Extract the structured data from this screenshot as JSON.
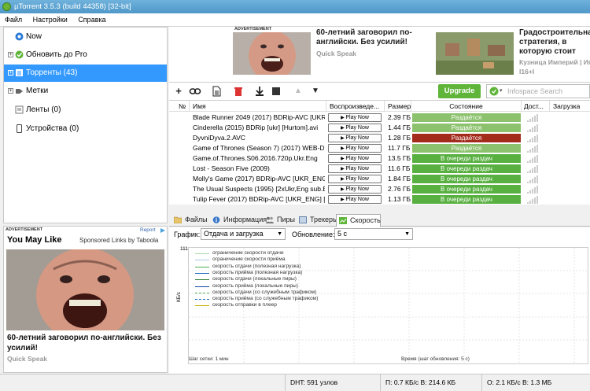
{
  "window": {
    "title": "µTorrent 3.5.3  (build 44358) [32-bit]"
  },
  "menu": [
    "Файл",
    "Настройки",
    "Справка"
  ],
  "sidebar": {
    "items": [
      {
        "label": "Now",
        "icon": "now-icon"
      },
      {
        "label": "Обновить до Pro",
        "icon": "pro-icon"
      },
      {
        "label": "Торренты (43)",
        "icon": "torrents-icon"
      },
      {
        "label": "Метки",
        "icon": "labels-icon"
      },
      {
        "label": "Ленты (0)",
        "icon": "feeds-icon"
      },
      {
        "label": "Устройства (0)",
        "icon": "devices-icon"
      }
    ]
  },
  "top_ads": {
    "label": "ADVERTISEMENT",
    "ad1": {
      "title": "60-летний заговорил по-английски. Без усилий!",
      "source": "Quick Speak"
    },
    "ad2": {
      "title": "Градостроительная стратегия, в которую стоит поиграть",
      "source": "Кузница Империй | Игр",
      "extra": "I16+I"
    }
  },
  "side_ad": {
    "label": "ADVERTISEMENT",
    "report": "Report",
    "headline": "You May Like",
    "sponsor": "Sponsored Links by Taboola",
    "title": "60-летний заговорил по-английски. Без усилий!",
    "source": "Quick Speak"
  },
  "toolbar": {
    "upgrade_label": "Upgrade",
    "search_placeholder": "Infospace Search"
  },
  "table": {
    "columns": [
      "№",
      "Имя",
      "Воспроизведе...",
      "Размер",
      "Состояние",
      "Дост...",
      "Загрузка"
    ],
    "play_label": "Play Now",
    "rows": [
      {
        "name": "Blade Runner 2049 (2017) BDRip-AVC [UKR_...",
        "size": "2.39 ГБ",
        "status": "Раздаётся",
        "kind": "seed"
      },
      {
        "name": "Cinderella (2015) BDRip [ukr] [Hurtom].avi",
        "size": "1.44 ГБ",
        "status": "Раздаётся",
        "kind": "seed"
      },
      {
        "name": "DyvniDyva.2.AVC",
        "size": "1.28 ГБ",
        "status": "Раздаётся",
        "kind": "active"
      },
      {
        "name": "Game of Thrones (Season 7) (2017) WEB-DL ...",
        "size": "11.7 ГБ",
        "status": "Раздаётся",
        "kind": "seed"
      },
      {
        "name": "Game.of.Thrones.S06.2016.720p.Ukr.Eng",
        "size": "13.5 ГБ",
        "status": "В очереди раздач",
        "kind": "queue"
      },
      {
        "name": "Lost - Season Five (2009)",
        "size": "11.6 ГБ",
        "status": "В очереди раздач",
        "kind": "queue"
      },
      {
        "name": "Molly's Game (2017) BDRip-AVC [UKR_ENG] ...",
        "size": "1.84 ГБ",
        "status": "В очереди раздач",
        "kind": "queue"
      },
      {
        "name": "The Usual Suspects (1995) [2xUkr,Eng sub.E...",
        "size": "2.76 ГБ",
        "status": "В очереди раздач",
        "kind": "queue"
      },
      {
        "name": "Tulip Fever (2017) BDRip-AVC [UKR_ENG] [...",
        "size": "1.13 ГБ",
        "status": "В очереди раздач",
        "kind": "queue"
      }
    ]
  },
  "tabs": [
    "Файлы",
    "Информация",
    "Пиры",
    "Трекеры",
    "Скорость"
  ],
  "speed": {
    "graph_label": "График:",
    "graph_value": "Отдача и загрузка",
    "update_label": "Обновление:",
    "update_value": "5 с",
    "y_max": "111",
    "y_unit": "КБ/с",
    "grid_step": "Шаг сетки: 1 мин",
    "time_label": "Время (шаг обновления: 5 с)",
    "legend": [
      {
        "label": "ограничение скорости отдачи",
        "color": "#a8d8a8",
        "dashed": false
      },
      {
        "label": "ограничение скорости приёма",
        "color": "#a8c8e8",
        "dashed": false
      },
      {
        "label": "скорость отдачи (полезная нагрузка)",
        "color": "#4caf50",
        "dashed": false
      },
      {
        "label": "скорость приёма (полезная нагрузка)",
        "color": "#1e6fc0",
        "dashed": false
      },
      {
        "label": "скорость отдачи (локальные пиры)",
        "color": "#2e7d32",
        "dashed": false
      },
      {
        "label": "скорость приёма (локальные пиры)",
        "color": "#0d47a1",
        "dashed": false
      },
      {
        "label": "скорость отдачи (со служебным трафиком)",
        "color": "#4caf50",
        "dashed": true
      },
      {
        "label": "скорость приёма (со служебным трафиком)",
        "color": "#1e6fc0",
        "dashed": true
      },
      {
        "label": "скорость отправки в плеер",
        "color": "#c8b400",
        "dashed": false
      }
    ]
  },
  "statusbar": {
    "dht": "DHT: 591 узлов",
    "down": "П: 0.7 КБ/с В: 214.6 КБ",
    "up": "О: 2.1 КБ/с В: 1.3 МБ"
  },
  "colors": {
    "seed": "#8cc26d",
    "active": "#a32b1c",
    "queue": "#58b040",
    "selection": "#3399ff",
    "upgrade": "#5fb53a"
  }
}
